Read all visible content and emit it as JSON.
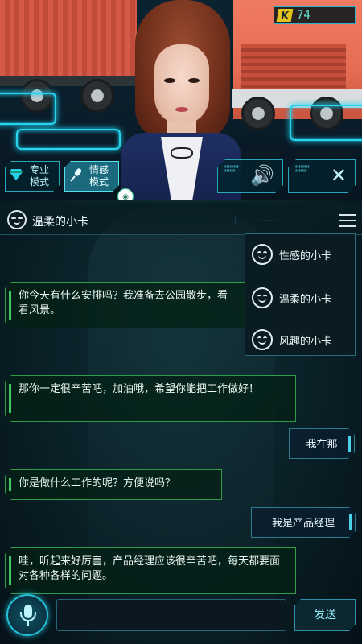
{
  "topbar": {
    "k_icon": "K",
    "k_value": "74"
  },
  "modes": [
    {
      "line1": "专业",
      "line2": "模式",
      "icon": "diamond-icon"
    },
    {
      "line1": "情感",
      "line2": "模式",
      "icon": "microphone-icon"
    }
  ],
  "controls": {
    "volume_icon": "speaker-icon",
    "close_icon": "close-icon",
    "volume_glyph": "🔊",
    "close_glyph": "✕"
  },
  "header": {
    "persona_name": "温柔的小卡",
    "menu_icon": "hamburger-icon"
  },
  "persona_menu": [
    {
      "label": "性感的小卡"
    },
    {
      "label": "温柔的小卡"
    },
    {
      "label": "风趣的小卡"
    }
  ],
  "messages": [
    {
      "role": "bot",
      "text": "你今天有什么安排吗？我准备去公园散步，看看风景。"
    },
    {
      "role": "bot",
      "text": "那你一定很辛苦吧，加油哦，希望你能把工作做好！"
    },
    {
      "role": "user",
      "text": "我在那"
    },
    {
      "role": "bot",
      "text": "你是做什么工作的呢？方便说吗？"
    },
    {
      "role": "user",
      "text": "我是产品经理"
    },
    {
      "role": "bot",
      "text": "哇，听起来好厉害，产品经理应该很辛苦吧，每天都要面对各种各样的问题。"
    }
  ],
  "input": {
    "value": "",
    "placeholder": ""
  },
  "send_label": "发送",
  "colors": {
    "accent": "#28d4ee",
    "bot_border": "#2f9c4a",
    "user_border": "#2d7b8f",
    "k_badge": "#e2c21b"
  }
}
